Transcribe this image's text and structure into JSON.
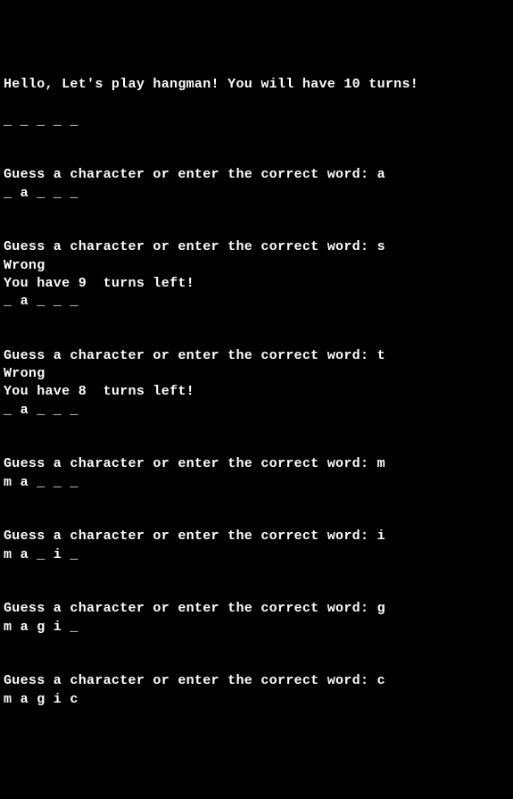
{
  "lines": [
    "Hello, Let's play hangman! You will have 10 turns!",
    "",
    "_ _ _ _ _ ",
    "",
    "",
    "Guess a character or enter the correct word: a",
    "_ a _ _ _ ",
    "",
    "",
    "Guess a character or enter the correct word: s",
    "Wrong",
    "You have 9  turns left!",
    "_ a _ _ _ ",
    "",
    "",
    "Guess a character or enter the correct word: t",
    "Wrong",
    "You have 8  turns left!",
    "_ a _ _ _ ",
    "",
    "",
    "Guess a character or enter the correct word: m",
    "m a _ _ _ ",
    "",
    "",
    "Guess a character or enter the correct word: i",
    "m a _ i _ ",
    "",
    "",
    "Guess a character or enter the correct word: g",
    "m a g i _ ",
    "",
    "",
    "Guess a character or enter the correct word: c",
    "m a g i c "
  ]
}
